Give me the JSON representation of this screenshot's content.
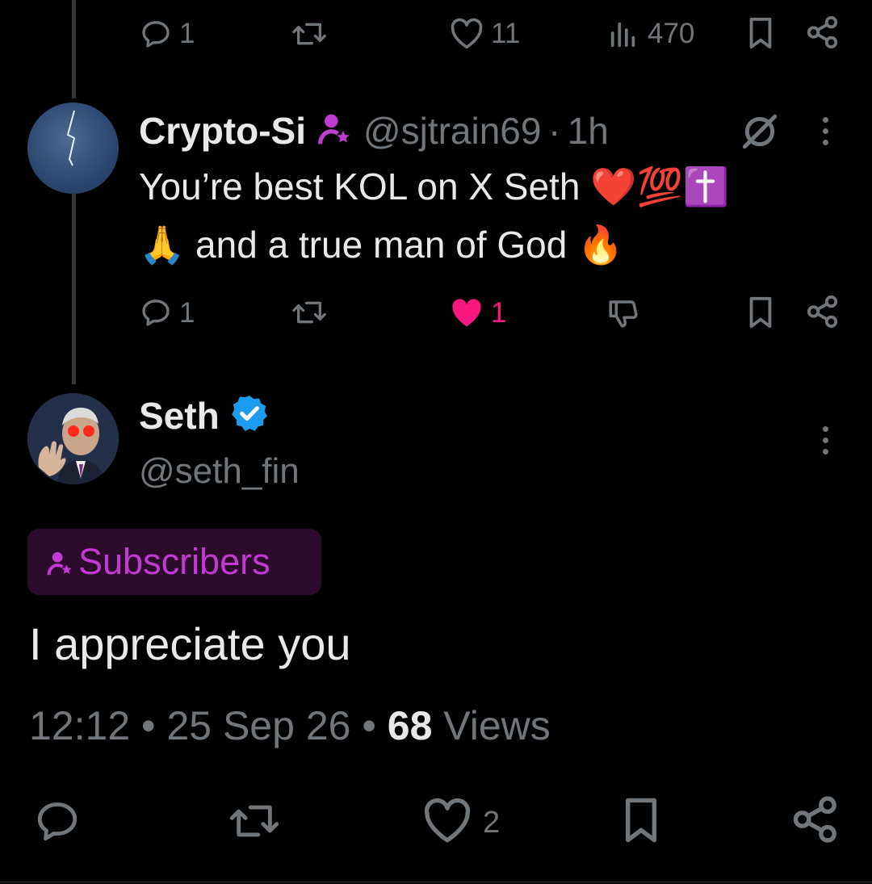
{
  "top_actions": {
    "reply_count": "1",
    "like_count": "11",
    "view_count": "470"
  },
  "reply_tweet": {
    "display_name": "Crypto-Si",
    "handle": "@sjtrain69",
    "separator": "·",
    "time": "1h",
    "text_line1": "You’re best KOL on X Seth ❤️💯✝️",
    "text_line2": "🙏 and a true man of God 🔥",
    "reply_count": "1",
    "like_count": "1"
  },
  "main_tweet": {
    "display_name": "Seth",
    "handle": "@seth_fin",
    "badge_label": "Subscribers",
    "text": "I appreciate you",
    "time": "12:12",
    "date": "25 Sep 26",
    "dot": "•",
    "views_count": "68",
    "views_label": "Views",
    "like_count": "2"
  },
  "colors": {
    "background": "#000000",
    "text": "#e7e9ea",
    "muted": "#71767b",
    "like_active": "#f91880",
    "subscriber_purple": "#c03bd1",
    "verified_blue": "#1d9bf0"
  },
  "icons": [
    "reply-icon",
    "retweet-icon",
    "like-icon",
    "views-icon",
    "bookmark-icon",
    "share-icon",
    "grok-icon",
    "more-icon",
    "dislike-icon",
    "verified-icon",
    "subscriber-icon"
  ]
}
